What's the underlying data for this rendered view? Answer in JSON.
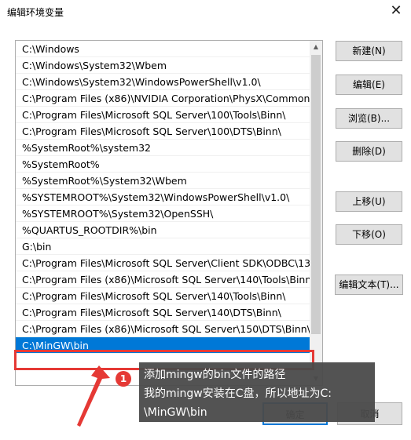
{
  "window": {
    "title": "编辑环境变量",
    "close_glyph": "✕"
  },
  "path_list": [
    "C:\\Windows",
    "C:\\Windows\\System32\\Wbem",
    "C:\\Windows\\System32\\WindowsPowerShell\\v1.0\\",
    "C:\\Program Files (x86)\\NVIDIA Corporation\\PhysX\\Common",
    "C:\\Program Files\\Microsoft SQL Server\\100\\Tools\\Binn\\",
    "C:\\Program Files\\Microsoft SQL Server\\100\\DTS\\Binn\\",
    "%SystemRoot%\\system32",
    "%SystemRoot%",
    "%SystemRoot%\\System32\\Wbem",
    "%SYSTEMROOT%\\System32\\WindowsPowerShell\\v1.0\\",
    "%SYSTEMROOT%\\System32\\OpenSSH\\",
    "%QUARTUS_ROOTDIR%\\bin",
    "G:\\bin",
    "C:\\Program Files\\Microsoft SQL Server\\Client SDK\\ODBC\\13...",
    "C:\\Program Files (x86)\\Microsoft SQL Server\\140\\Tools\\Binn\\",
    "C:\\Program Files\\Microsoft SQL Server\\140\\Tools\\Binn\\",
    "C:\\Program Files\\Microsoft SQL Server\\140\\DTS\\Binn\\",
    "C:\\Program Files (x86)\\Microsoft SQL Server\\150\\DTS\\Binn\\",
    "C:\\MinGW\\bin"
  ],
  "selected_index": 18,
  "buttons": {
    "new": "新建(N)",
    "edit": "编辑(E)",
    "browse": "浏览(B)...",
    "delete": "删除(D)",
    "move_up": "上移(U)",
    "move_down": "下移(O)",
    "edit_text": "编辑文本(T)...",
    "ok": "确定",
    "cancel": "取消"
  },
  "annotation": {
    "badge": "1",
    "lines": [
      "添加mingw的bin文件的路径",
      "我的mingw安装在C盘，所以地址为C:",
      "\\MinGW\\bin"
    ],
    "highlight_color": "#e53935"
  },
  "colors": {
    "selection": "#0078d7",
    "button_face": "#e1e1e1"
  }
}
